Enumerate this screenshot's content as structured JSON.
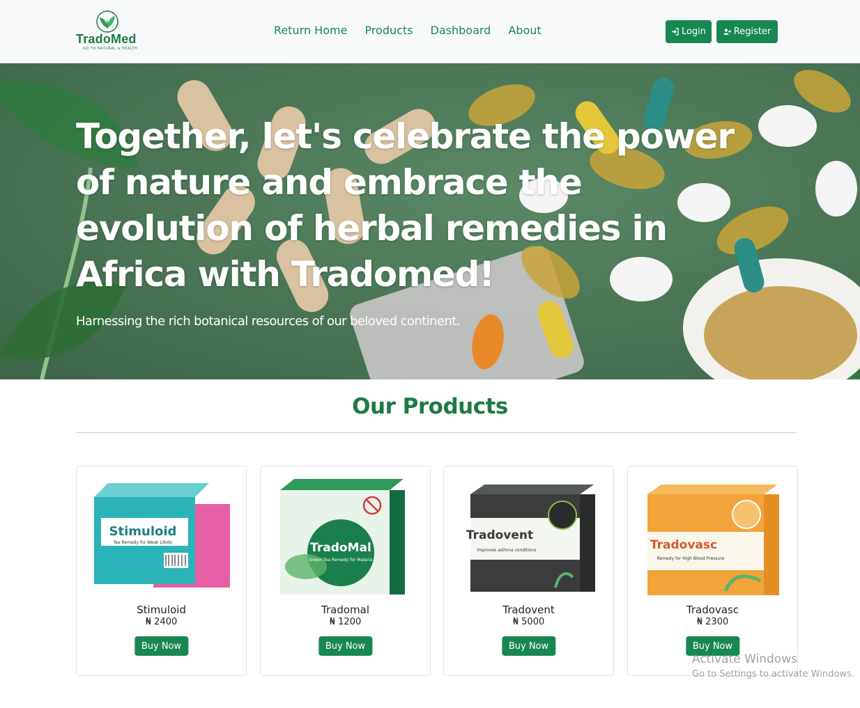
{
  "brand": {
    "name": "TradoMed",
    "tagline": "GO TO NATURAL & HEALTH"
  },
  "nav": {
    "links": [
      "Return Home",
      "Products",
      "Dashboard",
      "About"
    ],
    "login_label": "Login",
    "register_label": "Register"
  },
  "hero": {
    "title": "Together, let's celebrate the power of nature and embrace the evolution of herbal remedies in Africa with Tradomed!",
    "subtitle": "Harnessing the rich botanical resources of our beloved continent."
  },
  "products": {
    "heading": "Our Products",
    "items": [
      {
        "name": "Stimuloid",
        "price": "₦ 2400",
        "buy_label": "Buy Now",
        "box_title": "Stimuloid",
        "box_sub": "Tea Remedy for Weak Libido",
        "box_color": "#2bb3b8"
      },
      {
        "name": "Tradomal",
        "price": "₦ 1200",
        "buy_label": "Buy Now",
        "box_title": "TradoMal",
        "box_sub": "Green Tea Remedy for Malaria",
        "box_color": "#1b7f4d"
      },
      {
        "name": "Tradovent",
        "price": "₦ 5000",
        "buy_label": "Buy Now",
        "box_title": "Tradovent",
        "box_sub": "Improves asthma conditions",
        "box_color": "#3a3d3b"
      },
      {
        "name": "Tradovasc",
        "price": "₦ 2300",
        "buy_label": "Buy Now",
        "box_title": "Tradovasc",
        "box_sub": "Remedy for High Blood Pressure",
        "box_color": "#f2a33a"
      }
    ]
  },
  "watermark": {
    "line1": "Activate Windows",
    "line2": "Go to Settings to activate Windows."
  },
  "colors": {
    "brand_green": "#198754",
    "heading_green": "#1e7a45",
    "hero_bg": "#4b7757"
  }
}
